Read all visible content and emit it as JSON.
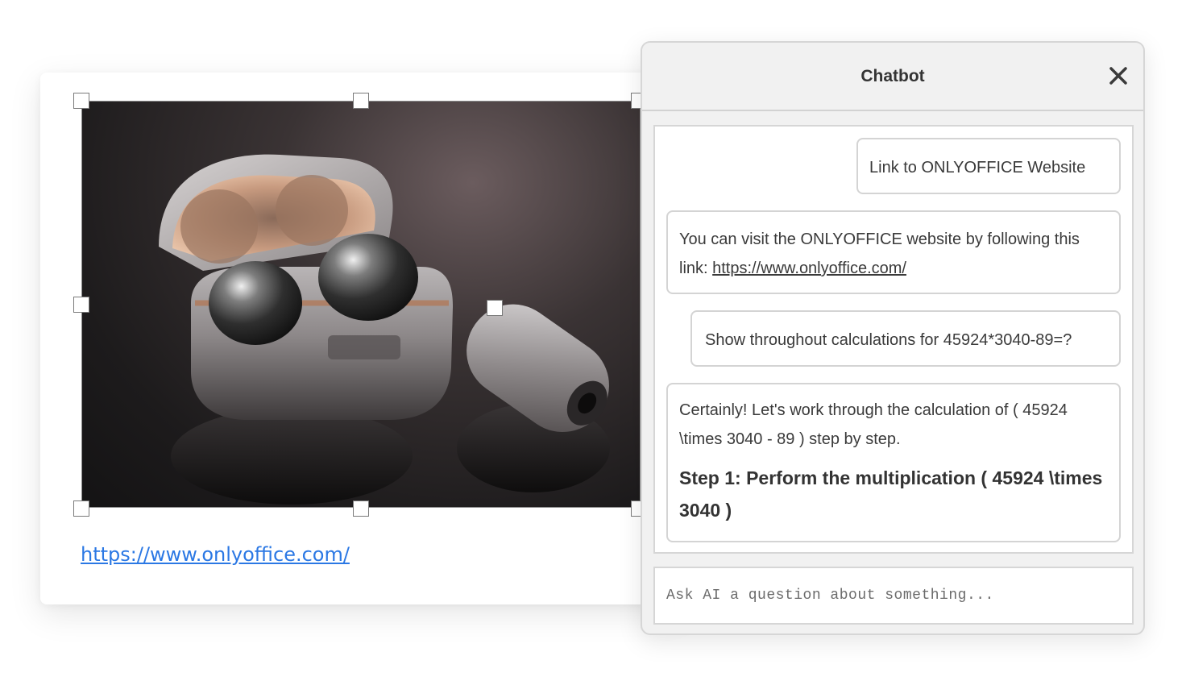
{
  "document": {
    "link_text": "https://www.onlyoffice.com/"
  },
  "chatbot": {
    "title": "Chatbot",
    "close_icon": "close-icon",
    "messages": [
      {
        "role": "user",
        "text": "Link to ONLYOFFICE Website"
      },
      {
        "role": "assistant",
        "text_before": "You can visit the ONLYOFFICE website by following this link: ",
        "link": "https://www.onlyoffice.com/"
      },
      {
        "role": "user",
        "text": "Show throughout calculations for 45924*3040-89=?"
      },
      {
        "role": "assistant",
        "text": "Certainly! Let's work through the calculation of ( 45924 \\times 3040 - 89 ) step by step.",
        "bold": "Step 1: Perform the multiplication ( 45924 \\times 3040 )"
      }
    ],
    "input_placeholder": "Ask AI a question about something..."
  },
  "colors": {
    "link_blue": "#2b78e4",
    "panel_bg": "#f1f1f1",
    "border": "#d6d6d6"
  }
}
